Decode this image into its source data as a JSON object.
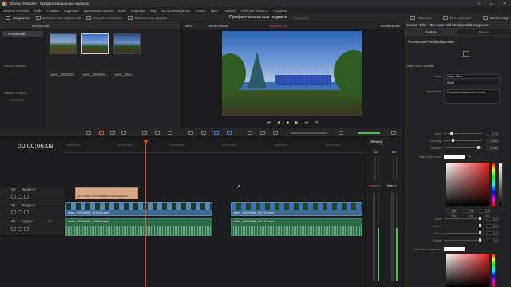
{
  "window": {
    "title": "DaVinci Resolve - Профессиональные надписи"
  },
  "menu": [
    "DaVinci Resolve",
    "Файл",
    "Правка",
    "Подгонка",
    "Временная шкала",
    "Клип",
    "Маркеры",
    "Вид",
    "Воспроизведение",
    "Fusion",
    "Цвет",
    "Fairlight",
    "Рабочая область",
    "Справка"
  ],
  "toolbar": {
    "media_pool": "Медиапул",
    "effects": "Библиотека эффектов",
    "edit_index": "Индекс монтажа",
    "sound_library": "Библиотека звуков",
    "project_title": "Профессиональные надписи",
    "project_status": "Отредакт.",
    "mixer": "Микшер",
    "metadata": "Метаданные",
    "inspector": "Инспектор"
  },
  "media_pool": {
    "header": "Основной",
    "bins_selected": "Основной",
    "smart_bins_label": "Умные ящики",
    "power_bins_label": "Power ящики",
    "keywords_label": "Keywords",
    "clips": [
      "video_2020008...",
      "video_2020009...",
      "video_2020..."
    ]
  },
  "viewer": {
    "zoom": "28%",
    "timecode_left": "00:00:23:06",
    "timeline_name": "Timeline 1",
    "timecode_right": "00:00:06:09"
  },
  "inspector": {
    "title": "Fusion Title : 3D Lower 3rd Multipanel Background",
    "tab_fusion": "Fusion",
    "tab_video": "Видео",
    "node_name": "ThreeDLowerThirdMultipanelBa",
    "section": "Main Text Controls",
    "font_label": "Font",
    "font_value": "Open Sans",
    "style_value": "Bold",
    "styled_text_label": "Styled Text",
    "styled_text_value": "Профессиональные титры",
    "size_label": "Size",
    "size_value": "0.79",
    "tracking_label": "Tracking",
    "tracking_value": "1.039",
    "opacity_label": "Opacity",
    "opacity_value": "0.906",
    "main_color_label": "Main Text Color",
    "hsv_h": "0.0",
    "hsv_s": "0.0",
    "hsv_v": "1.5",
    "hue_label": "Hue",
    "sat_label": "Sat",
    "val_label": "Val",
    "red_label": "Red",
    "red_value": "1.5",
    "green_label": "Green",
    "green_value": "1.5",
    "blue_label": "Blue",
    "blue_value": "1.5",
    "alpha_label": "Alpha",
    "alpha_value": "1.0",
    "specular_label": "Main Text Specular"
  },
  "timeline": {
    "timecode": "00:00:06:09",
    "ruler": [
      "00:00:00:00",
      "00:00:04:00",
      "00:00:08:00",
      "00:00:12:00",
      "00:00:16:00",
      "00:00:20:00"
    ],
    "tracks": {
      "v2": {
        "id": "V2",
        "name": "Видео 2",
        "clip": "3D Lower 3rd Multipanel Background"
      },
      "v1": {
        "id": "V1",
        "name": "Видео 1",
        "clip_a": "video_20200808_161539.mp4",
        "clip_b": "video_20200808_161734.mp4"
      },
      "a1": {
        "id": "A1",
        "name": "Аудио 1",
        "ch": "2.0",
        "clip_a": "video_20200808_161539.mp4",
        "clip_b": "video_20200808_161734.mp4"
      }
    }
  },
  "mixer": {
    "title": "Микшер",
    "ch1": "A1",
    "ch2": "M1",
    "strip1": "Аудио 1",
    "strip2": "Main 1"
  }
}
